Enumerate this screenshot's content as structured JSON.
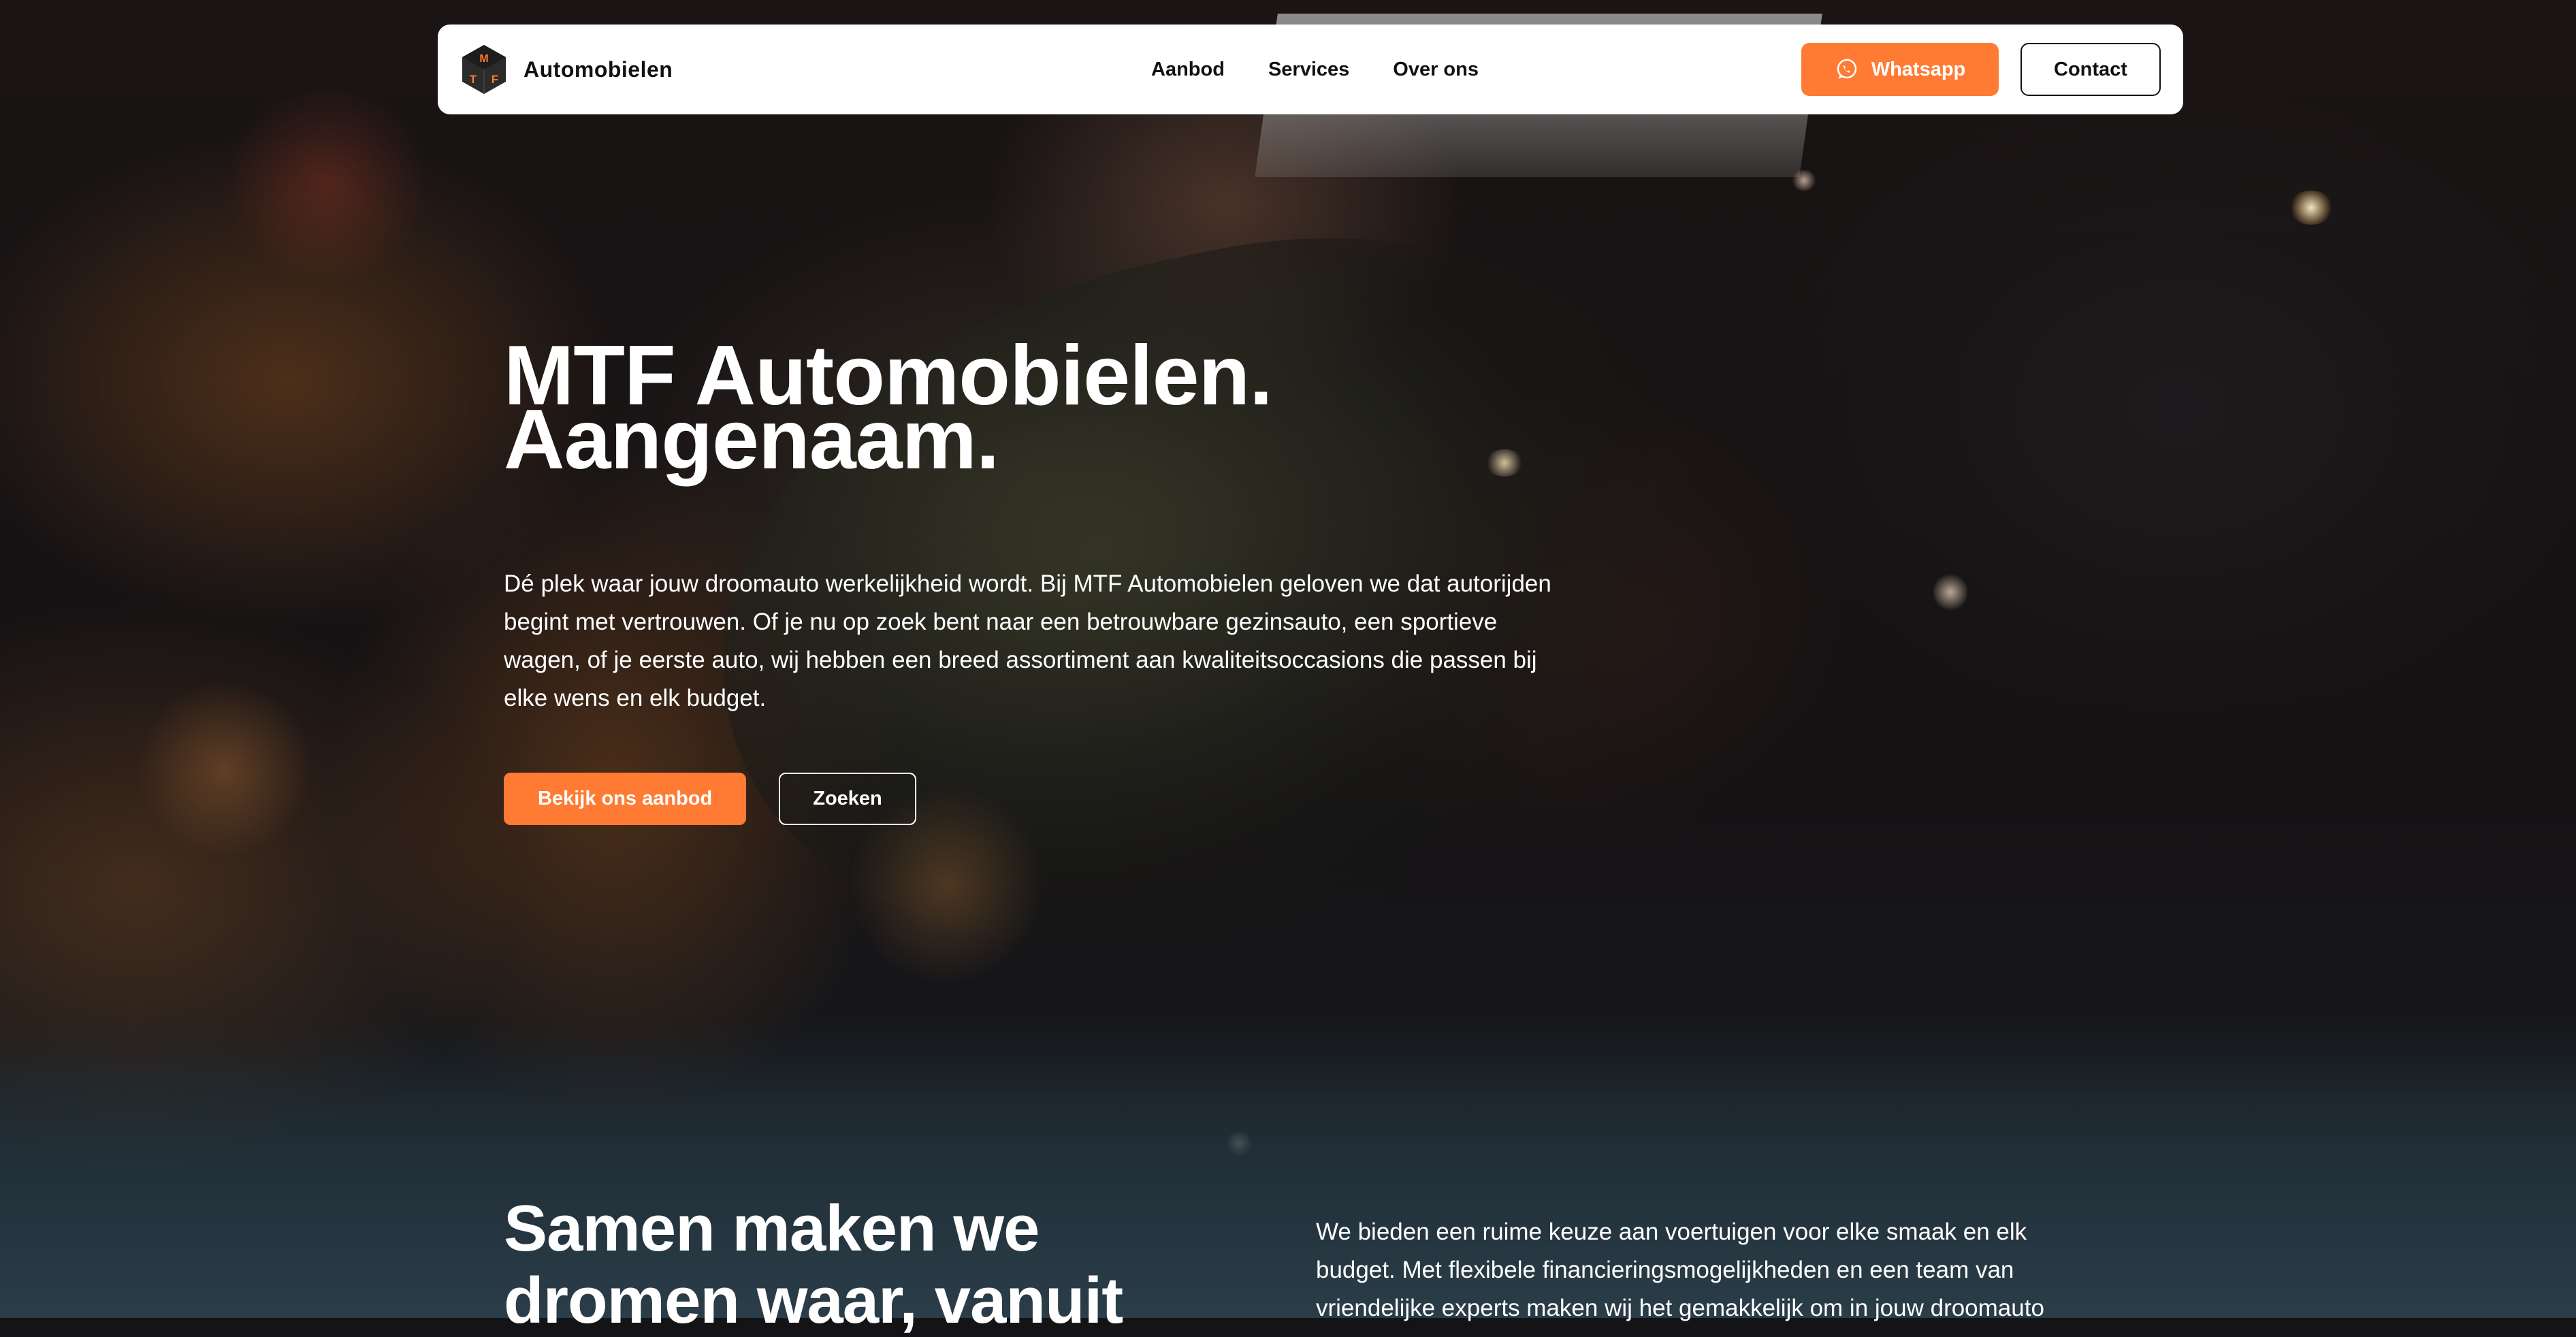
{
  "navbar": {
    "logo_text": "Automobielen",
    "logo_letters": [
      "M",
      "T",
      "F"
    ],
    "links": [
      "Aanbod",
      "Services",
      "Over ons"
    ],
    "whatsapp_label": "Whatsapp",
    "contact_label": "Contact"
  },
  "hero": {
    "title_line1": "MTF Automobielen.",
    "title_line2": "Aangenaam.",
    "description": "Dé plek waar jouw droomauto werkelijkheid wordt. Bij MTF Automobielen geloven we dat autorijden begint met vertrouwen. Of je nu op zoek bent naar een betrouwbare gezinsauto, een sportieve wagen, of je eerste auto, wij hebben een breed assortiment aan kwaliteitsoccasions die passen bij elke wens en elk budget.",
    "primary_button": "Bekijk ons aanbod",
    "secondary_button": "Zoeken"
  },
  "section": {
    "title_line1": "Samen maken we",
    "title_line2": "dromen waar, vanuit",
    "text": "We bieden een ruime keuze aan voertuigen voor elke smaak en elk budget. Met flexibele financieringsmogelijkheden en een team van vriendelijke experts maken wij het gemakkelijk om in jouw droomauto"
  },
  "colors": {
    "accent": "#ff7a33",
    "navbar_bg": "#ffffff",
    "text_dark": "#111111"
  },
  "icons": {
    "whatsapp": "whatsapp-icon",
    "logo": "cube-logo-icon"
  }
}
